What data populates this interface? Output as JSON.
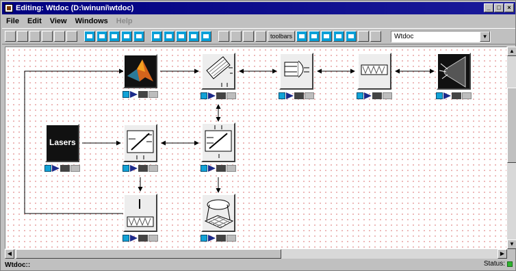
{
  "window": {
    "title": "Editing:  Wtdoc  (D:\\winuni\\wtdoc)"
  },
  "menubar": {
    "file": "File",
    "edit": "Edit",
    "view": "View",
    "windows": "Windows",
    "help": "Help"
  },
  "toolbar": {
    "tools_label": "toolbars",
    "combo_value": "Wtdoc"
  },
  "canvas": {
    "lasers_label": "Lasers"
  },
  "statusbar": {
    "left": "Wtdoc::",
    "right": "Status:"
  },
  "colors": {
    "title_bar": "#00007f",
    "status_led": "#2fb52f",
    "grid_dots": "#e7a0a0",
    "control_blue": "#12a2d6"
  }
}
